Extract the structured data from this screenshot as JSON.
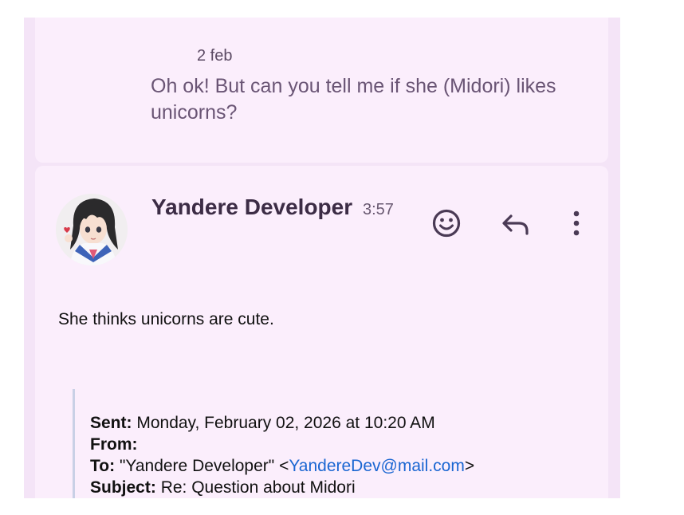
{
  "previous_message": {
    "date": "2 feb",
    "text": "Oh ok! But can you tell me if she (Midori) likes unicorns?"
  },
  "message": {
    "sender": "Yandere Developer",
    "time": "3:57",
    "body": "She thinks unicorns are cute.",
    "actions": {
      "emoji_icon": "smiley-face-icon",
      "reply_icon": "reply-arrow-icon",
      "more_icon": "more-vertical-icon"
    },
    "quoted": {
      "sent_label": "Sent:",
      "sent_value": "Monday, February 02, 2026 at 10:20 AM",
      "from_label": "From:",
      "from_value": "",
      "to_label": "To:",
      "to_name": "\"Yandere Developer\" <",
      "to_email": "YandereDev@mail.com",
      "to_close": ">",
      "subject_label": "Subject:",
      "subject_value": "Re: Question about Midori"
    }
  },
  "colors": {
    "background": "#f4e4f7",
    "card": "#fbeefc",
    "link": "#1a66d2",
    "icon": "#4a3a55"
  }
}
